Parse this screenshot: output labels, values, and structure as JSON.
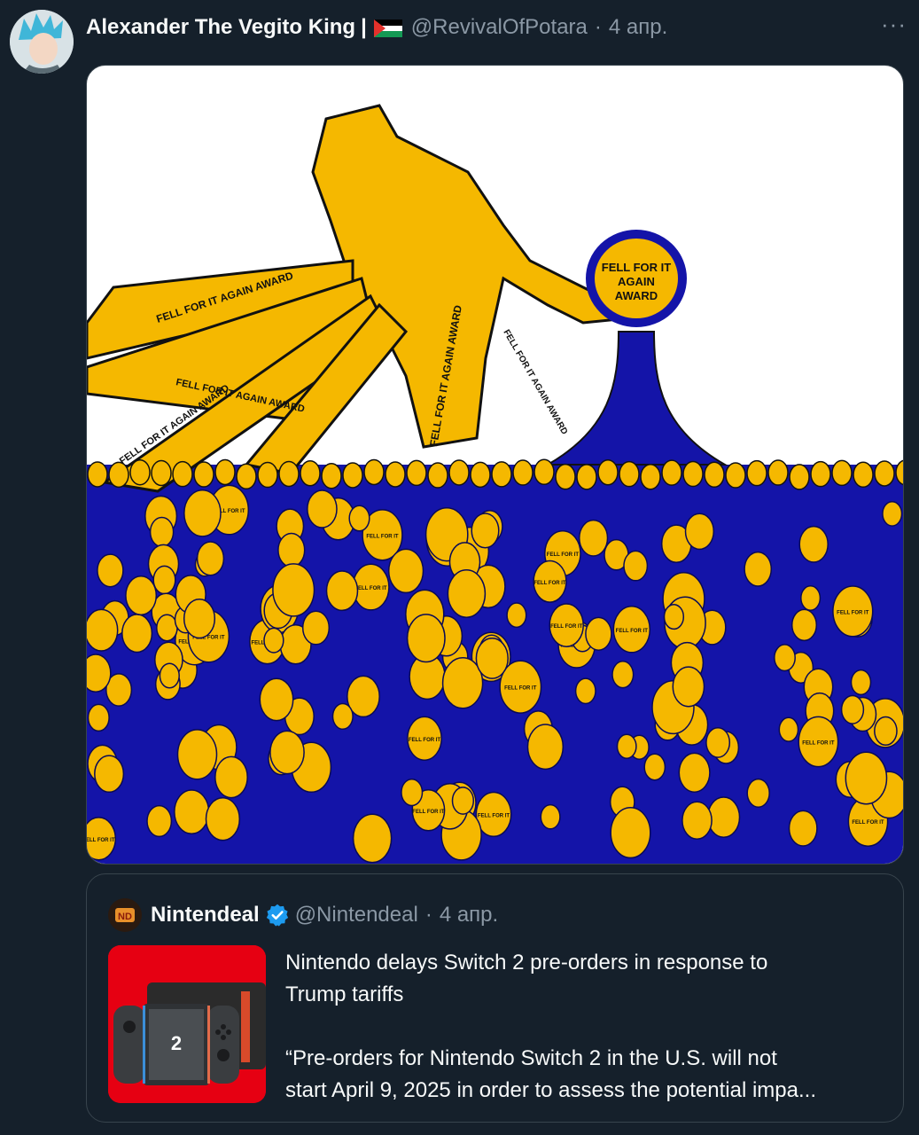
{
  "tweet": {
    "display_name": "Alexander The Vegito King",
    "separator": "|",
    "flag_icon": "palestine-flag-icon",
    "handle": "@RevivalOfPotara",
    "dot": "·",
    "date": "4 апр.",
    "more_label": "···"
  },
  "media": {
    "label_text": "FELL FOR IT AGAIN AWARD",
    "label_lines": [
      "FELL FOR IT",
      "AGAIN",
      "AWARD"
    ],
    "colors": {
      "blue": "#1414a8",
      "gold": "#f5b800",
      "outline": "#111111"
    }
  },
  "quote": {
    "logo_icon": "nintendeal-logo-icon",
    "name": "Nintendeal",
    "verified_icon": "verified-badge-icon",
    "handle": "@Nintendeal",
    "dot": "·",
    "date": "4 апр.",
    "line1": "Nintendo delays Switch 2 pre-orders in response to",
    "line2": "Trump tariffs",
    "line3": "“Pre-orders for Nintendo Switch 2 in the U.S. will not",
    "line4": "start April 9, 2025 in order to assess the potential impa..."
  },
  "colors": {
    "background": "#15202b",
    "text_primary": "#f7f9f9",
    "text_secondary": "#8b98a5",
    "border": "#38444d",
    "verified": "#1d9bf0",
    "nintendo_red": "#e60012"
  }
}
